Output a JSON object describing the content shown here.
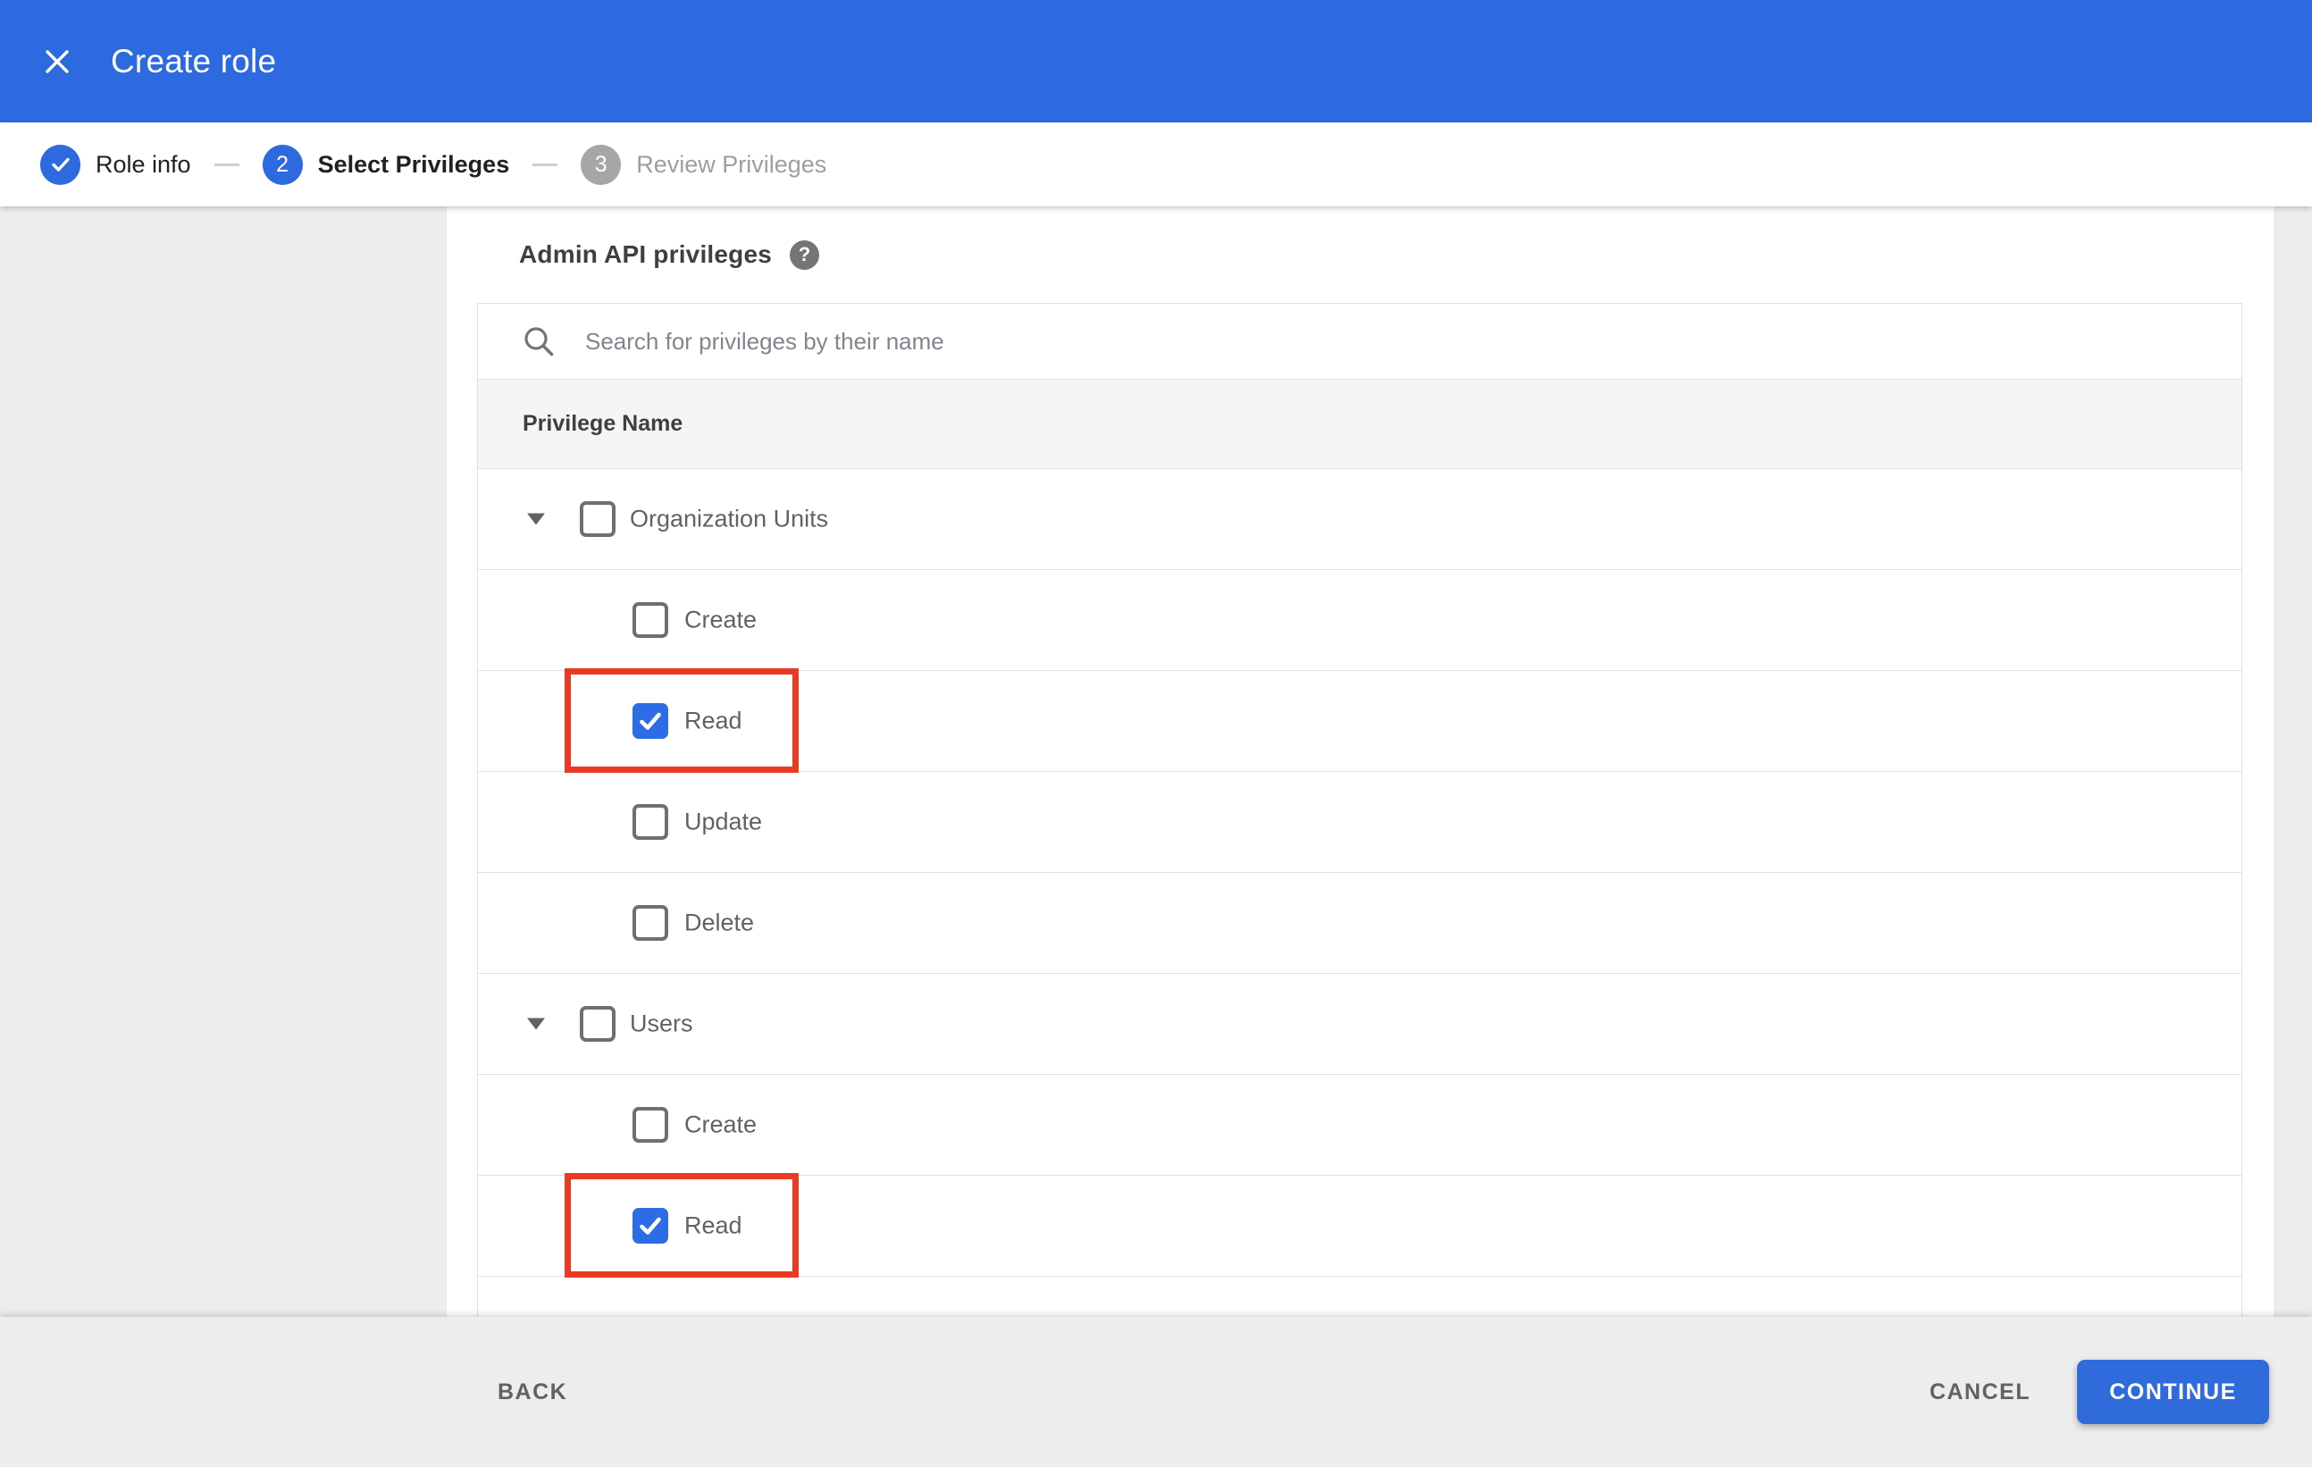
{
  "header": {
    "title": "Create role"
  },
  "stepper": {
    "steps": [
      {
        "label": "Role info",
        "state": "complete"
      },
      {
        "number": "2",
        "label": "Select Privileges",
        "state": "active"
      },
      {
        "number": "3",
        "label": "Review Privileges",
        "state": "upcoming"
      }
    ]
  },
  "content": {
    "section_title": "Admin API privileges",
    "help_icon": "?",
    "search_placeholder": "Search for privileges by their name",
    "table": {
      "column_header": "Privilege Name",
      "rows": [
        {
          "label": "Organization Units",
          "type": "group",
          "expanded": true,
          "checked": false,
          "highlighted": false
        },
        {
          "label": "Create",
          "type": "child",
          "checked": false,
          "highlighted": false
        },
        {
          "label": "Read",
          "type": "child",
          "checked": true,
          "highlighted": true
        },
        {
          "label": "Update",
          "type": "child",
          "checked": false,
          "highlighted": false
        },
        {
          "label": "Delete",
          "type": "child",
          "checked": false,
          "highlighted": false
        },
        {
          "label": "Users",
          "type": "group",
          "expanded": true,
          "checked": false,
          "highlighted": false
        },
        {
          "label": "Create",
          "type": "child",
          "checked": false,
          "highlighted": false
        },
        {
          "label": "Read",
          "type": "child",
          "checked": true,
          "highlighted": true
        }
      ]
    }
  },
  "footer": {
    "back_label": "BACK",
    "cancel_label": "CANCEL",
    "continue_label": "CONTINUE"
  },
  "colors": {
    "accent_blue": "#2d6ae0",
    "checkbox_checked_blue": "#2c6ce4",
    "annotation_red": "#e83b21",
    "footer_gray": "#ededed",
    "table_header_gray": "#f5f5f5"
  }
}
